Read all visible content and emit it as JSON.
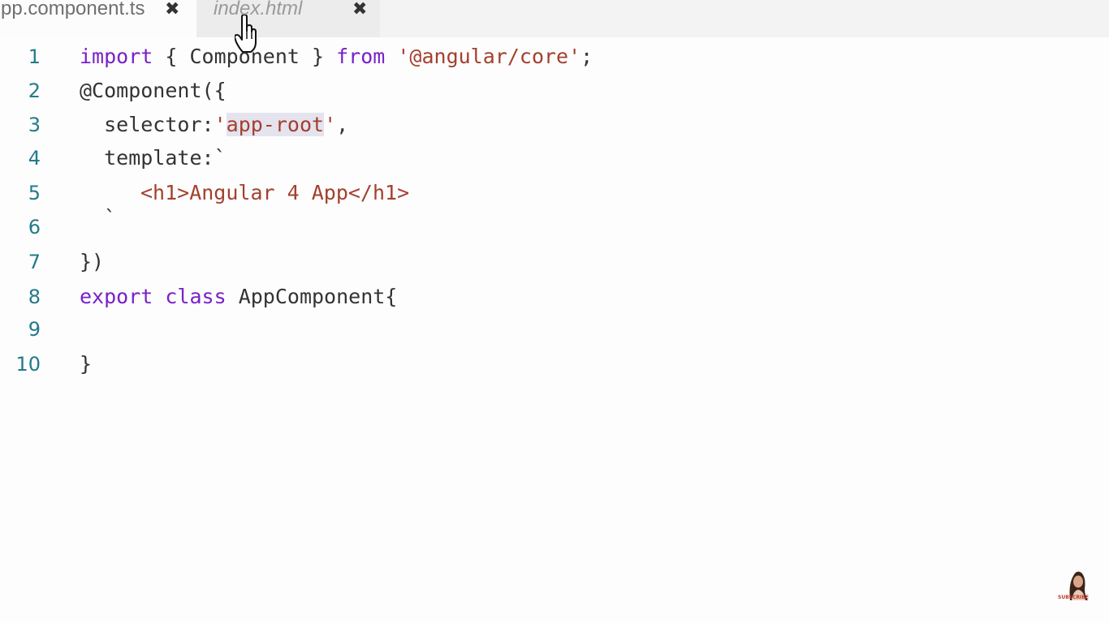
{
  "tabs": [
    {
      "label": "pp.component.ts",
      "close_icon": "close-icon",
      "active": true
    },
    {
      "label": "index.html",
      "close_icon": "close-icon",
      "active": false
    }
  ],
  "editor": {
    "lines": [
      {
        "number": "1"
      },
      {
        "number": "2"
      },
      {
        "number": "3"
      },
      {
        "number": "4"
      },
      {
        "number": "5"
      },
      {
        "number": "6"
      },
      {
        "number": "7"
      },
      {
        "number": "8"
      },
      {
        "number": "9"
      },
      {
        "number": "10"
      }
    ],
    "tokens": {
      "l1_import": "import",
      "l1_brace": " { Component } ",
      "l1_from": "from",
      "l1_sp": " ",
      "l1_str": "'@angular/core'",
      "l1_semi": ";",
      "l2": "@Component({",
      "l3_key": "  selector:",
      "l3_q1": "'",
      "l3_str": "app-root",
      "l3_q2": "'",
      "l3_comma": ",",
      "l4": "  template:`",
      "l5": "<h1>Angular 4 App</h1>",
      "l6": "`",
      "l7": "})",
      "l8_export": "export",
      "l8_sp": " ",
      "l8_class": "class",
      "l8_rest": " AppComponent{",
      "l9": "",
      "l10": "}"
    }
  },
  "watermark": {
    "avatar_icon": "avatar-icon",
    "label": "SUBSCRIBE"
  },
  "colors": {
    "keyword": "#7a1fc9",
    "string": "#a3402e",
    "line_number": "#247a8a",
    "selection": "#e4e3ee"
  }
}
